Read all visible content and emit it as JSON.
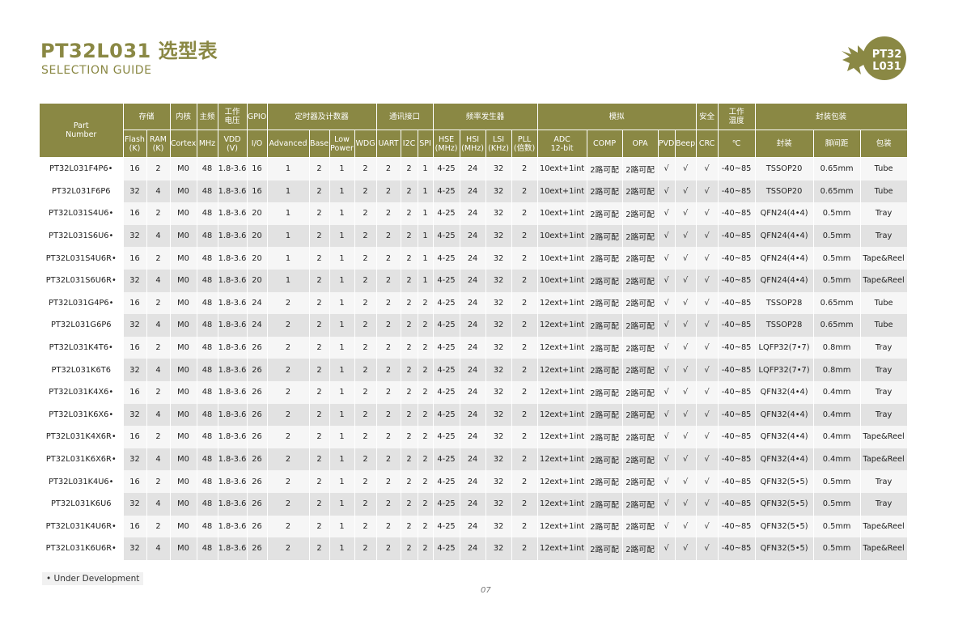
{
  "title": "PT32L031 选型表",
  "subtitle": "SELECTION GUIDE",
  "logo": {
    "line1": "PT32",
    "line2": "L031",
    "color": "#8a8844"
  },
  "colors": {
    "accent": "#8a8844",
    "row_light": "#f6f6f6",
    "row_dark": "#e2e2e2"
  },
  "header_groups": [
    {
      "label": "Part\nNumber",
      "colspan": 1,
      "rowspan": 2
    },
    {
      "label": "存储",
      "colspan": 2
    },
    {
      "label": "内核",
      "colspan": 1
    },
    {
      "label": "主频",
      "colspan": 1
    },
    {
      "label": "工作\n电压",
      "colspan": 1
    },
    {
      "label": "GPIO",
      "colspan": 1
    },
    {
      "label": "定时器及计数器",
      "colspan": 4
    },
    {
      "label": "通讯接口",
      "colspan": 3
    },
    {
      "label": "频率发生器",
      "colspan": 4
    },
    {
      "label": "模拟",
      "colspan": 5
    },
    {
      "label": "安全",
      "colspan": 1
    },
    {
      "label": "工作\n温度",
      "colspan": 1
    },
    {
      "label": "封装包装",
      "colspan": 3
    }
  ],
  "sub_headers": [
    "Flash\n(K)",
    "RAM\n(K)",
    "Cortex",
    "MHz",
    "VDD\n(V)",
    "I/O",
    "Advanced",
    "Base",
    "Low\nPower",
    "WDG",
    "UART",
    "I2C",
    "SPI",
    "HSE\n(MHz)",
    "HSI\n(MHz)",
    "LSI\n(KHz)",
    "PLL\n(倍数)",
    "ADC\n12-bit",
    "COMP",
    "OPA",
    "PVD",
    "Beep",
    "CRC",
    "℃",
    "封装",
    "脚间距",
    "包装"
  ],
  "rows": [
    [
      "PT32L031F4P6•",
      "16",
      "2",
      "M0",
      "48",
      "1.8-3.6",
      "16",
      "1",
      "2",
      "1",
      "2",
      "2",
      "2",
      "1",
      "4-25",
      "24",
      "32",
      "2",
      "10ext+1int",
      "2路可配",
      "2路可配",
      "√",
      "√",
      "√",
      "-40~85",
      "TSSOP20",
      "0.65mm",
      "Tube"
    ],
    [
      "PT32L031F6P6",
      "32",
      "4",
      "M0",
      "48",
      "1.8-3.6",
      "16",
      "1",
      "2",
      "1",
      "2",
      "2",
      "2",
      "1",
      "4-25",
      "24",
      "32",
      "2",
      "10ext+1int",
      "2路可配",
      "2路可配",
      "√",
      "√",
      "√",
      "-40~85",
      "TSSOP20",
      "0.65mm",
      "Tube"
    ],
    [
      "PT32L031S4U6•",
      "16",
      "2",
      "M0",
      "48",
      "1.8-3.6",
      "20",
      "1",
      "2",
      "1",
      "2",
      "2",
      "2",
      "1",
      "4-25",
      "24",
      "32",
      "2",
      "10ext+1int",
      "2路可配",
      "2路可配",
      "√",
      "√",
      "√",
      "-40~85",
      "QFN24(4•4)",
      "0.5mm",
      "Tray"
    ],
    [
      "PT32L031S6U6•",
      "32",
      "4",
      "M0",
      "48",
      "1.8-3.6",
      "20",
      "1",
      "2",
      "1",
      "2",
      "2",
      "2",
      "1",
      "4-25",
      "24",
      "32",
      "2",
      "10ext+1int",
      "2路可配",
      "2路可配",
      "√",
      "√",
      "√",
      "-40~85",
      "QFN24(4•4)",
      "0.5mm",
      "Tray"
    ],
    [
      "PT32L031S4U6R•",
      "16",
      "2",
      "M0",
      "48",
      "1.8-3.6",
      "20",
      "1",
      "2",
      "1",
      "2",
      "2",
      "2",
      "1",
      "4-25",
      "24",
      "32",
      "2",
      "10ext+1int",
      "2路可配",
      "2路可配",
      "√",
      "√",
      "√",
      "-40~85",
      "QFN24(4•4)",
      "0.5mm",
      "Tape&Reel"
    ],
    [
      "PT32L031S6U6R•",
      "32",
      "4",
      "M0",
      "48",
      "1.8-3.6",
      "20",
      "1",
      "2",
      "1",
      "2",
      "2",
      "2",
      "1",
      "4-25",
      "24",
      "32",
      "2",
      "10ext+1int",
      "2路可配",
      "2路可配",
      "√",
      "√",
      "√",
      "-40~85",
      "QFN24(4•4)",
      "0.5mm",
      "Tape&Reel"
    ],
    [
      "PT32L031G4P6•",
      "16",
      "2",
      "M0",
      "48",
      "1.8-3.6",
      "24",
      "2",
      "2",
      "1",
      "2",
      "2",
      "2",
      "2",
      "4-25",
      "24",
      "32",
      "2",
      "12ext+1int",
      "2路可配",
      "2路可配",
      "√",
      "√",
      "√",
      "-40~85",
      "TSSOP28",
      "0.65mm",
      "Tube"
    ],
    [
      "PT32L031G6P6",
      "32",
      "4",
      "M0",
      "48",
      "1.8-3.6",
      "24",
      "2",
      "2",
      "1",
      "2",
      "2",
      "2",
      "2",
      "4-25",
      "24",
      "32",
      "2",
      "12ext+1int",
      "2路可配",
      "2路可配",
      "√",
      "√",
      "√",
      "-40~85",
      "TSSOP28",
      "0.65mm",
      "Tube"
    ],
    [
      "PT32L031K4T6•",
      "16",
      "2",
      "M0",
      "48",
      "1.8-3.6",
      "26",
      "2",
      "2",
      "1",
      "2",
      "2",
      "2",
      "2",
      "4-25",
      "24",
      "32",
      "2",
      "12ext+1int",
      "2路可配",
      "2路可配",
      "√",
      "√",
      "√",
      "-40~85",
      "LQFP32(7•7)",
      "0.8mm",
      "Tray"
    ],
    [
      "PT32L031K6T6",
      "32",
      "4",
      "M0",
      "48",
      "1.8-3.6",
      "26",
      "2",
      "2",
      "1",
      "2",
      "2",
      "2",
      "2",
      "4-25",
      "24",
      "32",
      "2",
      "12ext+1int",
      "2路可配",
      "2路可配",
      "√",
      "√",
      "√",
      "-40~85",
      "LQFP32(7•7)",
      "0.8mm",
      "Tray"
    ],
    [
      "PT32L031K4X6•",
      "16",
      "2",
      "M0",
      "48",
      "1.8-3.6",
      "26",
      "2",
      "2",
      "1",
      "2",
      "2",
      "2",
      "2",
      "4-25",
      "24",
      "32",
      "2",
      "12ext+1int",
      "2路可配",
      "2路可配",
      "√",
      "√",
      "√",
      "-40~85",
      "QFN32(4•4)",
      "0.4mm",
      "Tray"
    ],
    [
      "PT32L031K6X6•",
      "32",
      "4",
      "M0",
      "48",
      "1.8-3.6",
      "26",
      "2",
      "2",
      "1",
      "2",
      "2",
      "2",
      "2",
      "4-25",
      "24",
      "32",
      "2",
      "12ext+1int",
      "2路可配",
      "2路可配",
      "√",
      "√",
      "√",
      "-40~85",
      "QFN32(4•4)",
      "0.4mm",
      "Tray"
    ],
    [
      "PT32L031K4X6R•",
      "16",
      "2",
      "M0",
      "48",
      "1.8-3.6",
      "26",
      "2",
      "2",
      "1",
      "2",
      "2",
      "2",
      "2",
      "4-25",
      "24",
      "32",
      "2",
      "12ext+1int",
      "2路可配",
      "2路可配",
      "√",
      "√",
      "√",
      "-40~85",
      "QFN32(4•4)",
      "0.4mm",
      "Tape&Reel"
    ],
    [
      "PT32L031K6X6R•",
      "32",
      "4",
      "M0",
      "48",
      "1.8-3.6",
      "26",
      "2",
      "2",
      "1",
      "2",
      "2",
      "2",
      "2",
      "4-25",
      "24",
      "32",
      "2",
      "12ext+1int",
      "2路可配",
      "2路可配",
      "√",
      "√",
      "√",
      "-40~85",
      "QFN32(4•4)",
      "0.4mm",
      "Tape&Reel"
    ],
    [
      "PT32L031K4U6•",
      "16",
      "2",
      "M0",
      "48",
      "1.8-3.6",
      "26",
      "2",
      "2",
      "1",
      "2",
      "2",
      "2",
      "2",
      "4-25",
      "24",
      "32",
      "2",
      "12ext+1int",
      "2路可配",
      "2路可配",
      "√",
      "√",
      "√",
      "-40~85",
      "QFN32(5•5)",
      "0.5mm",
      "Tray"
    ],
    [
      "PT32L031K6U6",
      "32",
      "4",
      "M0",
      "48",
      "1.8-3.6",
      "26",
      "2",
      "2",
      "1",
      "2",
      "2",
      "2",
      "2",
      "4-25",
      "24",
      "32",
      "2",
      "12ext+1int",
      "2路可配",
      "2路可配",
      "√",
      "√",
      "√",
      "-40~85",
      "QFN32(5•5)",
      "0.5mm",
      "Tray"
    ],
    [
      "PT32L031K4U6R•",
      "16",
      "2",
      "M0",
      "48",
      "1.8-3.6",
      "26",
      "2",
      "2",
      "1",
      "2",
      "2",
      "2",
      "2",
      "4-25",
      "24",
      "32",
      "2",
      "12ext+1int",
      "2路可配",
      "2路可配",
      "√",
      "√",
      "√",
      "-40~85",
      "QFN32(5•5)",
      "0.5mm",
      "Tape&Reel"
    ],
    [
      "PT32L031K6U6R•",
      "32",
      "4",
      "M0",
      "48",
      "1.8-3.6",
      "26",
      "2",
      "2",
      "1",
      "2",
      "2",
      "2",
      "2",
      "4-25",
      "24",
      "32",
      "2",
      "12ext+1int",
      "2路可配",
      "2路可配",
      "√",
      "√",
      "√",
      "-40~85",
      "QFN32(5•5)",
      "0.5mm",
      "Tape&Reel"
    ]
  ],
  "footnote": "• Under Development",
  "page_number": "07"
}
